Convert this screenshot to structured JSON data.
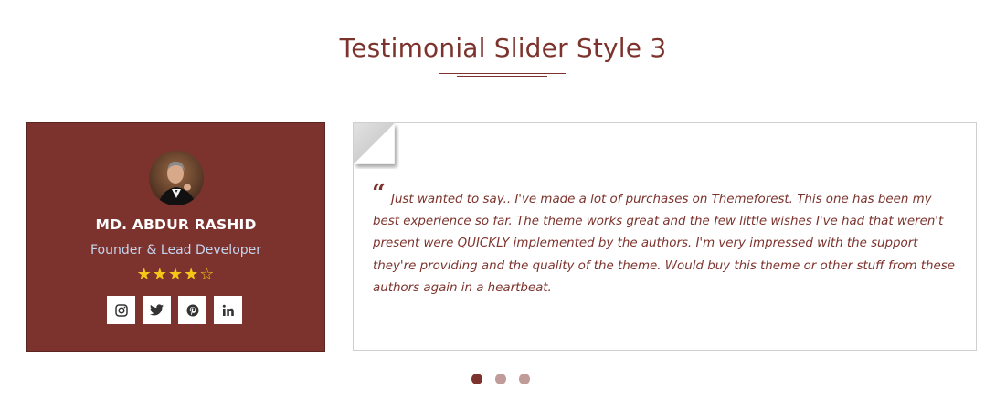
{
  "section": {
    "title": "Testimonial Slider Style 3"
  },
  "profile": {
    "name": "MD. ABDUR RASHID",
    "role": "Founder & Lead Developer",
    "rating": 4,
    "rating_max": 5,
    "stars": [
      "★",
      "★",
      "★",
      "★",
      "☆"
    ],
    "socials": [
      {
        "icon": "instagram-icon"
      },
      {
        "icon": "twitter-icon"
      },
      {
        "icon": "pinterest-icon"
      },
      {
        "icon": "linkedin-icon"
      }
    ]
  },
  "testimonial": {
    "quote_mark": "“",
    "text": "Just wanted to say.. I've made a lot of purchases on Themeforest. This one has been my best experience so far. The theme works great and the few little wishes I've had that weren't present were QUICKLY implemented by the authors. I'm very impressed with the support they're providing and the quality of the theme. Would buy this theme or other stuff from these authors again in a heartbeat."
  },
  "slider": {
    "dot_count": 3,
    "active_index": 0
  },
  "colors": {
    "brand": "#7d332d",
    "role_text": "#c6d4ee",
    "star": "#f5c518",
    "dot_inactive": "#c19b97"
  }
}
